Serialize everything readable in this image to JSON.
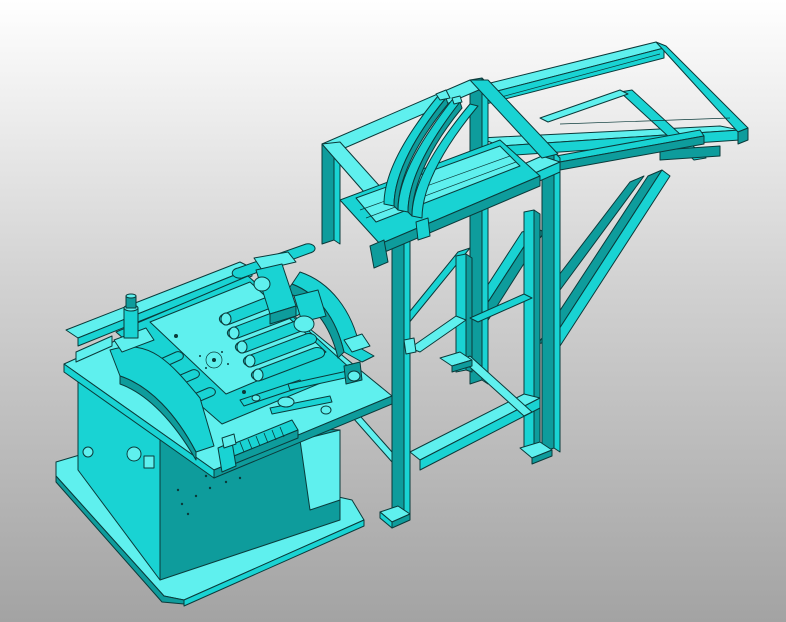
{
  "viewport": {
    "background_top": "#ffffff",
    "background_bottom": "#a3a3a3"
  },
  "model": {
    "color_face": "#19d3d3",
    "color_light": "#5ff0ee",
    "color_dark": "#0e9c9c",
    "edge_color": "#0b3a3a",
    "shading": "shaded-with-edges",
    "parts": [
      "machine-base",
      "roller-table",
      "guide-arms",
      "linkage-mechanism",
      "clamp-assembly",
      "motor-cylinder",
      "frame-structure",
      "upper-rail-frame",
      "curved-guide-rails",
      "diagonal-braces",
      "support-feet"
    ]
  }
}
